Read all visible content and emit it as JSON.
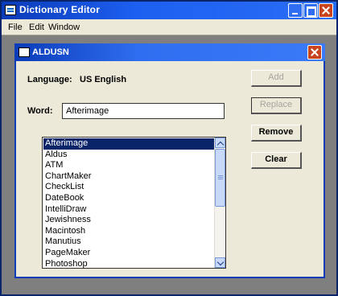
{
  "app": {
    "title": "Dictionary Editor"
  },
  "menu": {
    "file": "File",
    "edit": "Edit",
    "window": "Window"
  },
  "dialog": {
    "title": "ALDUSN",
    "language_label": "Language:",
    "language_value": "US English",
    "word_label": "Word:",
    "word_value": "Afterimage"
  },
  "buttons": {
    "add": "Add",
    "replace": "Replace",
    "remove": "Remove",
    "clear": "Clear"
  },
  "list": {
    "items": [
      "Afterimage",
      "Aldus",
      "ATM",
      "ChartMaker",
      "CheckList",
      "DateBook",
      "IntelliDraw",
      "Jewishness",
      "Macintosh",
      "Manutius",
      "PageMaker",
      "Photoshop"
    ],
    "selected_index": 0
  },
  "colors": {
    "title_bar": "#0a3bb8",
    "selection": "#0a246a",
    "close_button": "#c9441c"
  }
}
